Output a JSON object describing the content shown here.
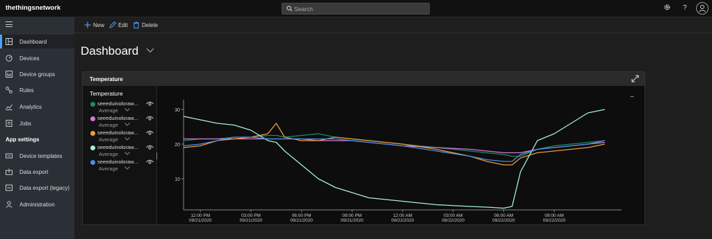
{
  "app": {
    "brand": "thethingsnetwork"
  },
  "search": {
    "placeholder": "Search"
  },
  "topbar": {
    "icons": [
      "gear-icon",
      "help-icon",
      "avatar-icon"
    ],
    "help_label": "?"
  },
  "sidebar": {
    "items": [
      {
        "label": "Dashboard",
        "icon": "dashboard-icon",
        "active": true
      },
      {
        "label": "Devices",
        "icon": "devices-icon"
      },
      {
        "label": "Device groups",
        "icon": "device-groups-icon"
      },
      {
        "label": "Rules",
        "icon": "rules-icon"
      },
      {
        "label": "Analytics",
        "icon": "analytics-icon"
      },
      {
        "label": "Jobs",
        "icon": "jobs-icon"
      }
    ],
    "section_label": "App settings",
    "settings_items": [
      {
        "label": "Device templates",
        "icon": "device-templates-icon"
      },
      {
        "label": "Data export",
        "icon": "data-export-icon"
      },
      {
        "label": "Data export (legacy)",
        "icon": "data-export-legacy-icon"
      },
      {
        "label": "Administration",
        "icon": "administration-icon"
      }
    ]
  },
  "toolbar": {
    "new_label": "New",
    "edit_label": "Edit",
    "delete_label": "Delete"
  },
  "page": {
    "title": "Dashboard"
  },
  "tile": {
    "title": "Temperature",
    "legend_title": "Temperature",
    "legend": [
      {
        "name": "seeeduinoloraw...",
        "aggregation": "Average",
        "color": "#1f8a6a"
      },
      {
        "name": "seeeduinoloraw...",
        "aggregation": "Average",
        "color": "#d47ad6"
      },
      {
        "name": "seeeduinoloraw...",
        "aggregation": "Average",
        "color": "#f29a3d"
      },
      {
        "name": "seeeduinoloraw...",
        "aggregation": "Average",
        "color": "#a6f0d8"
      },
      {
        "name": "seeeduinoloraw...",
        "aggregation": "Average",
        "color": "#4a90e2"
      }
    ],
    "more_label": "..."
  },
  "chart_data": {
    "type": "line",
    "title": "",
    "xlabel": "",
    "ylabel": "",
    "x": [
      "2020-09-21 11:00",
      "2020-09-21 12:00",
      "2020-09-21 13:00",
      "2020-09-21 14:00",
      "2020-09-21 15:00",
      "2020-09-21 16:00",
      "2020-09-21 16:30",
      "2020-09-21 17:00",
      "2020-09-21 18:00",
      "2020-09-21 19:00",
      "2020-09-21 20:00",
      "2020-09-21 21:00",
      "2020-09-21 22:00",
      "2020-09-22 00:00",
      "2020-09-22 02:00",
      "2020-09-22 04:00",
      "2020-09-22 05:00",
      "2020-09-22 06:00",
      "2020-09-22 06:30",
      "2020-09-22 07:00",
      "2020-09-22 08:00",
      "2020-09-22 09:00",
      "2020-09-22 10:00",
      "2020-09-22 11:00",
      "2020-09-22 12:00"
    ],
    "x_ticks": [
      {
        "at": "2020-09-21 12:00",
        "time": "12:00 PM",
        "date": "09/21/2020"
      },
      {
        "at": "2020-09-21 15:00",
        "time": "03:00 PM",
        "date": "09/21/2020"
      },
      {
        "at": "2020-09-21 18:00",
        "time": "06:00 PM",
        "date": "09/21/2020"
      },
      {
        "at": "2020-09-21 21:00",
        "time": "09:00 PM",
        "date": "09/21/2020"
      },
      {
        "at": "2020-09-22 00:00",
        "time": "12:00 AM",
        "date": "09/22/2020"
      },
      {
        "at": "2020-09-22 03:00",
        "time": "03:00 AM",
        "date": "09/22/2020"
      },
      {
        "at": "2020-09-22 06:00",
        "time": "06:00 AM",
        "date": "09/22/2020"
      },
      {
        "at": "2020-09-22 09:00",
        "time": "09:00 AM",
        "date": "09/22/2020"
      }
    ],
    "x_range": [
      "2020-09-21 11:00",
      "2020-09-22 13:00"
    ],
    "y_ticks": [
      10,
      20,
      30
    ],
    "ylim": [
      1,
      32
    ],
    "grid": false,
    "series": [
      {
        "color": "#1f8a6a",
        "values": [
          21,
          21.5,
          21.5,
          22,
          22,
          22.5,
          22.5,
          22,
          22.5,
          23,
          22,
          21.5,
          21,
          20,
          19,
          18,
          17.5,
          17,
          16.5,
          16.5,
          18.5,
          19.5,
          20,
          20.5,
          21
        ]
      },
      {
        "color": "#d47ad6",
        "values": [
          21.5,
          21.5,
          21.5,
          21.5,
          21.5,
          21.5,
          21.5,
          21.5,
          21.5,
          21,
          21,
          21,
          20.5,
          19.5,
          19,
          18.5,
          18,
          17.5,
          17.5,
          17.5,
          18.5,
          19,
          19.5,
          20,
          20.5
        ]
      },
      {
        "color": "#f29a3d",
        "values": [
          19,
          19.5,
          21,
          21.5,
          22,
          23,
          26,
          22,
          21,
          21,
          22,
          21.5,
          21,
          20,
          18.5,
          16.5,
          15,
          14,
          14,
          16,
          17.5,
          18,
          18.5,
          19,
          20
        ]
      },
      {
        "color": "#a6f0d8",
        "values": [
          28,
          27,
          26,
          25.5,
          24,
          21,
          20.5,
          18,
          14,
          10,
          7.5,
          6,
          4.5,
          3.5,
          2.5,
          2,
          1.8,
          1.5,
          2,
          12,
          21,
          23,
          26,
          29,
          30
        ]
      },
      {
        "color": "#4a90e2",
        "values": [
          19.5,
          20,
          21,
          22,
          22,
          21.5,
          21.5,
          21.5,
          21.5,
          21.5,
          21.5,
          21,
          20.5,
          19.5,
          18,
          16.5,
          15.5,
          15,
          15,
          17,
          18.5,
          19,
          19.5,
          20,
          21
        ]
      }
    ]
  }
}
